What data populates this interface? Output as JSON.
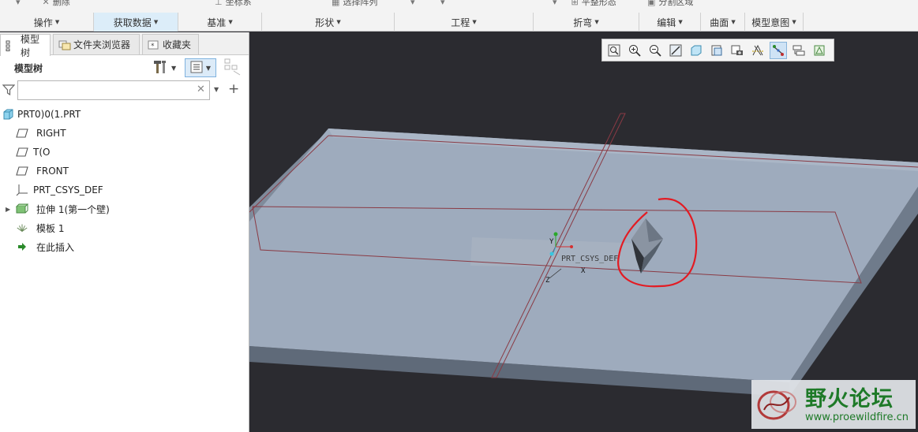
{
  "ribbon": {
    "top_strip": [
      "删除",
      "坐标系",
      "选择阵列",
      "平整形态",
      "分割区域"
    ],
    "groups": [
      {
        "label": "操作",
        "active": false
      },
      {
        "label": "获取数据",
        "active": true
      },
      {
        "label": "基准",
        "active": false
      },
      {
        "label": "形状",
        "active": false
      },
      {
        "label": "工程",
        "active": false
      },
      {
        "label": "折弯",
        "active": false
      },
      {
        "label": "编辑",
        "active": false
      },
      {
        "label": "曲面",
        "active": false
      },
      {
        "label": "模型意图",
        "active": false
      }
    ]
  },
  "left_panel": {
    "tabs": [
      {
        "label": "模型树",
        "icon": "model-tree-icon",
        "active": true
      },
      {
        "label": "文件夹浏览器",
        "icon": "folder-browser-icon",
        "active": false
      },
      {
        "label": "收藏夹",
        "icon": "favorites-icon",
        "active": false
      }
    ],
    "tree_title": "模型树",
    "search": {
      "value": "",
      "placeholder": ""
    },
    "tree": [
      {
        "label": "PRT0)0(1.PRT",
        "icon": "part-icon",
        "indent": 0,
        "expandable": false
      },
      {
        "label": "RIGHT",
        "icon": "datum-plane-icon",
        "indent": 1,
        "expandable": false
      },
      {
        "label": "T(O",
        "icon": "datum-plane-icon",
        "indent": 1,
        "expandable": false
      },
      {
        "label": "FRONT",
        "icon": "datum-plane-icon",
        "indent": 1,
        "expandable": false
      },
      {
        "label": "PRT_CSYS_DEF",
        "icon": "csys-icon",
        "indent": 1,
        "expandable": false
      },
      {
        "label": "拉伸 1(第一个壁)",
        "icon": "extrude-wall-icon",
        "indent": 1,
        "expandable": true
      },
      {
        "label": "模板 1",
        "icon": "template-icon",
        "indent": 1,
        "expandable": false
      },
      {
        "label": "在此插入",
        "icon": "insert-here-icon",
        "indent": 1,
        "expandable": false
      }
    ]
  },
  "viewport": {
    "csys_label": "PRT_CSYS_DEF",
    "axis_labels": {
      "x": "X",
      "y": "Y",
      "z": "Z"
    },
    "toolbar": [
      {
        "icon": "zoom-fit-icon",
        "active": false
      },
      {
        "icon": "zoom-in-icon",
        "active": false
      },
      {
        "icon": "zoom-out-icon",
        "active": false
      },
      {
        "icon": "repaint-icon",
        "active": false
      },
      {
        "icon": "display-style-icon",
        "active": false
      },
      {
        "icon": "saved-views-icon",
        "active": false
      },
      {
        "icon": "view-manager-icon",
        "active": false
      },
      {
        "icon": "datum-display-icon",
        "active": false
      },
      {
        "icon": "annotation-display-icon",
        "active": true
      },
      {
        "icon": "spin-center-icon",
        "active": false
      },
      {
        "icon": "sheetmetal-display-icon",
        "active": false
      }
    ],
    "colors": {
      "background": "#2b2b30",
      "plate_top": "#9eabbd",
      "plate_side": "#6e7a8a",
      "datum_planes": "#8a3a44",
      "annotation_circle": "#e31b23"
    }
  },
  "watermark": {
    "title": "野火论坛",
    "url": "www.proewildfire.cn"
  }
}
